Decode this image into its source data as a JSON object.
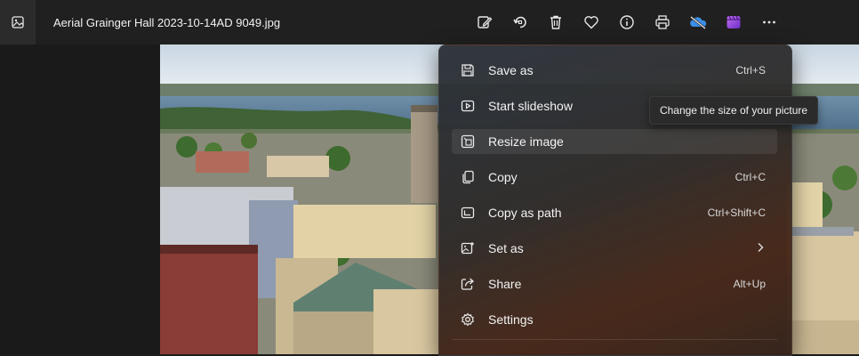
{
  "window": {
    "title": "Aerial Grainger Hall 2023-10-14AD 9049.jpg"
  },
  "toolbar": {
    "icons": [
      "edit-icon",
      "rotate-icon",
      "delete-icon",
      "favorite-icon",
      "info-icon",
      "print-icon",
      "onedrive-icon",
      "clipchamp-icon",
      "more-icon"
    ]
  },
  "menu": {
    "items": [
      {
        "label": "Save as",
        "shortcut": "Ctrl+S",
        "icon": "save-icon"
      },
      {
        "label": "Start slideshow",
        "shortcut": "",
        "icon": "slideshow-icon"
      },
      {
        "label": "Resize image",
        "shortcut": "",
        "icon": "resize-icon"
      },
      {
        "label": "Copy",
        "shortcut": "Ctrl+C",
        "icon": "copy-icon"
      },
      {
        "label": "Copy as path",
        "shortcut": "Ctrl+Shift+C",
        "icon": "copy-path-icon"
      },
      {
        "label": "Set as",
        "shortcut": "",
        "icon": "set-as-icon"
      },
      {
        "label": "Share",
        "shortcut": "Alt+Up",
        "icon": "share-icon"
      },
      {
        "label": "Settings",
        "shortcut": "",
        "icon": "settings-icon"
      }
    ]
  },
  "tooltip": {
    "text": "Change the size of your picture"
  },
  "colors": {
    "toolbar_bg": "#202020",
    "onedrive_blue": "#3a8ee6",
    "clipchamp_purple": "#9b4fd6"
  }
}
